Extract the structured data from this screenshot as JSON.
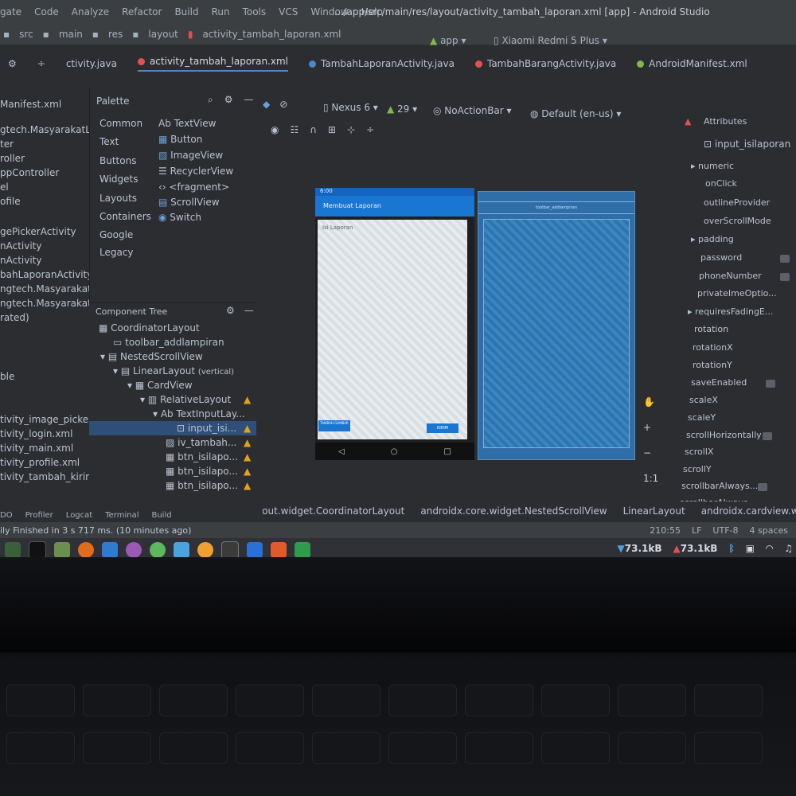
{
  "window": {
    "title": ".../app/src/main/res/layout/activity_tambah_laporan.xml [app] - Android Studio"
  },
  "menu": [
    "gate",
    "Code",
    "Analyze",
    "Refactor",
    "Build",
    "Run",
    "Tools",
    "VCS",
    "Window",
    "Help"
  ],
  "breadcrumbs": [
    "src",
    "main",
    "res",
    "layout",
    "activity_tambah_laporan.xml"
  ],
  "run": {
    "module": "app",
    "device": "Xiaomi Redmi 5 Plus"
  },
  "tabs": [
    {
      "label": "ctivity.java"
    },
    {
      "label": "activity_tambah_laporan.xml",
      "active": true
    },
    {
      "label": "TambahLaporanActivity.java"
    },
    {
      "label": "TambahBarangActivity.java"
    },
    {
      "label": "AndroidManifest.xml"
    }
  ],
  "project_tree": [
    "Manifest.xml",
    "gtech.MasyarakatL",
    "ter",
    "roller",
    "ppController",
    "el",
    "ofile",
    "gePickerActivity",
    "nActivity",
    "nActivity",
    "bahLaporanActivity",
    "ngtech.MasyarakatL",
    "ngtech.MasyarakatLa",
    "rated)",
    "ble",
    "tivity_image_picker.xml",
    "tivity_login.xml",
    "tivity_main.xml",
    "tivity_profile.xml",
    "tivity_tambah_kirimlap"
  ],
  "palette": {
    "title": "Palette",
    "categories": [
      "Common",
      "Text",
      "Buttons",
      "Widgets",
      "Layouts",
      "Containers",
      "Google",
      "Legacy"
    ],
    "widgets": [
      "Ab TextView",
      "Button",
      "ImageView",
      "RecyclerView",
      "<fragment>",
      "ScrollView",
      "Switch"
    ]
  },
  "design_toolbar": {
    "device": "Nexus 6",
    "api": "29",
    "theme": "NoActionBar",
    "locale": "Default (en-us)"
  },
  "component_tree": {
    "title": "Component Tree",
    "nodes": [
      {
        "label": "CoordinatorLayout",
        "depth": 0
      },
      {
        "label": "toolbar_addlampiran",
        "depth": 1
      },
      {
        "label": "NestedScrollView",
        "depth": 1
      },
      {
        "label": "LinearLayout",
        "suffix": "(vertical)",
        "depth": 2
      },
      {
        "label": "CardView",
        "depth": 3
      },
      {
        "label": "RelativeLayout",
        "depth": 4
      },
      {
        "label": "TextInputLay...",
        "depth": 5
      },
      {
        "label": "input_isi...",
        "depth": 6,
        "selected": true
      },
      {
        "label": "iv_tambah...",
        "depth": 5
      },
      {
        "label": "btn_isilapo...",
        "depth": 5
      },
      {
        "label": "btn_isilapo...",
        "depth": 5
      },
      {
        "label": "btn_isilapo...",
        "depth": 5
      }
    ]
  },
  "preview": {
    "status_time": "6:00",
    "appbar_title": "Membuat Laporan",
    "hint": "Isi Laporan",
    "btn_left": "TAMBAH GAMBAR",
    "btn_right": "KIRIM",
    "blueprint_label": "toolbar_addlampiran"
  },
  "attributes": {
    "title": "Attributes",
    "selected": "input_isilaporan",
    "rows": [
      "numeric",
      "onClick",
      "outlineProvider",
      "overScrollMode",
      "padding",
      "password",
      "phoneNumber",
      "privateImeOptio...",
      "requiresFadingE...",
      "rotation",
      "rotationX",
      "rotationY",
      "saveEnabled",
      "scaleX",
      "scaleY",
      "scrollHorizontally",
      "scrollX",
      "scrollY",
      "scrollbarAlways...",
      "scrollbarAlways..."
    ]
  },
  "zoom": {
    "fit": "1:1"
  },
  "navigation_path": [
    "androidx.coordinatorlayout.widget.CoordinatorLayout",
    "androidx.core.widget.NestedScrollView",
    "LinearLayout",
    "androidx.cardview.widget.CardVie"
  ],
  "tool_windows": [
    "DO",
    "Profiler",
    "Logcat",
    "Terminal",
    "Build"
  ],
  "status": {
    "message": "ily Finished in 3 s 717 ms. (10 minutes ago)",
    "position": "210:55",
    "line_sep": "LF",
    "encoding": "UTF-8",
    "indent": "4 spaces"
  },
  "taskbar": {
    "net_down": "73.1kB",
    "net_up": "73.1kB"
  }
}
